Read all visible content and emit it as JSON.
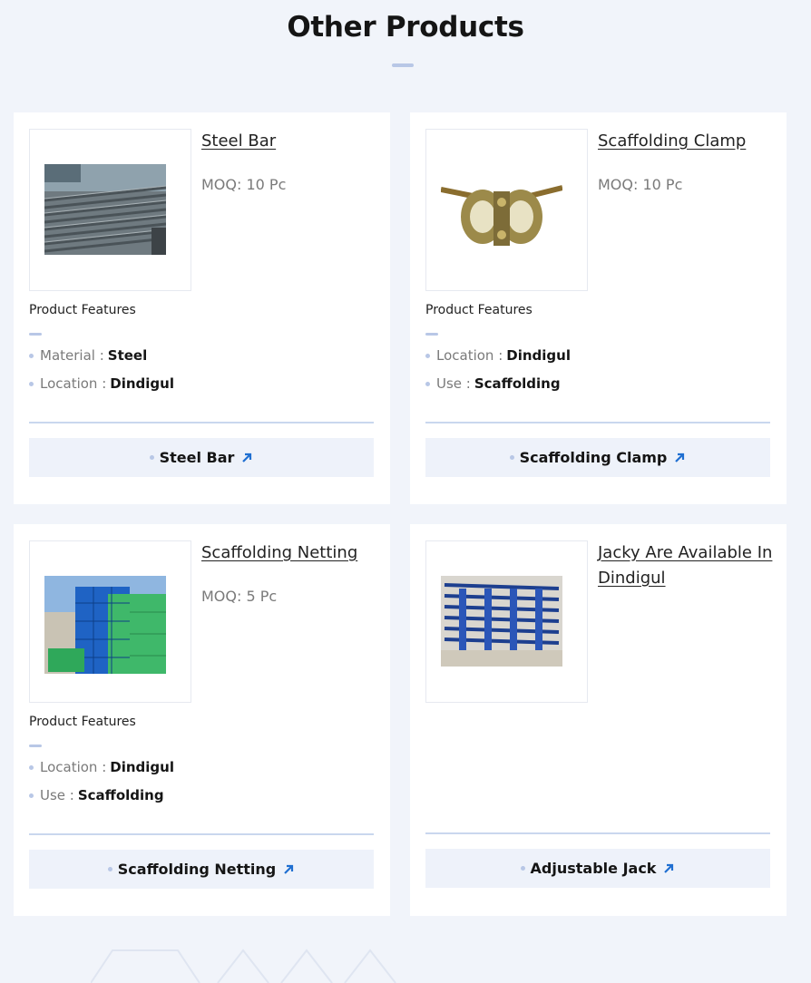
{
  "section": {
    "title": "Other Products"
  },
  "products": [
    {
      "title": "Steel Bar",
      "moq": "MOQ: 10 Pc",
      "features_title": "Product Features",
      "features": [
        {
          "key": "Material",
          "value": "Steel"
        },
        {
          "key": "Location",
          "value": "Dindigul"
        }
      ],
      "cta": "Steel Bar",
      "image_icon": "steel-bars-image"
    },
    {
      "title": "Scaffolding Clamp",
      "moq": "MOQ: 10 Pc",
      "features_title": "Product Features",
      "features": [
        {
          "key": "Location",
          "value": "Dindigul"
        },
        {
          "key": "Use",
          "value": "Scaffolding"
        }
      ],
      "cta": "Scaffolding Clamp",
      "image_icon": "clamp-image"
    },
    {
      "title": "Scaffolding Netting",
      "moq": "MOQ: 5 Pc",
      "features_title": "Product Features",
      "features": [
        {
          "key": "Location",
          "value": "Dindigul"
        },
        {
          "key": "Use",
          "value": "Scaffolding"
        }
      ],
      "cta": "Scaffolding Netting",
      "image_icon": "netting-image"
    },
    {
      "title": "Jacky Are Available In Dindigul",
      "cta": "Adjustable Jack",
      "image_icon": "jack-image"
    }
  ],
  "colors": {
    "background": "#f1f4fa",
    "accent_light": "#b8c7e6",
    "arrow": "#1f6fd1",
    "cta_bg": "#eef2fa"
  },
  "icons": {
    "cta_arrow": "arrow-up-right-icon",
    "bullet": "dot-icon"
  }
}
